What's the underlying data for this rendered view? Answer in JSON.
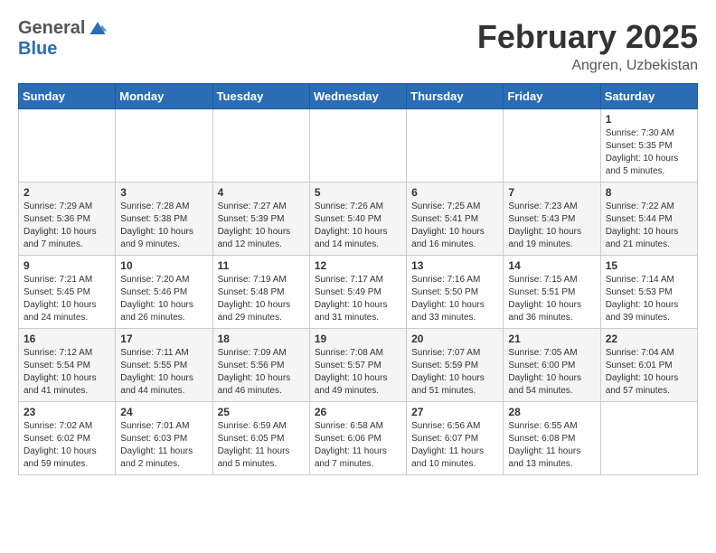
{
  "header": {
    "logo_general": "General",
    "logo_blue": "Blue",
    "month_title": "February 2025",
    "location": "Angren, Uzbekistan"
  },
  "days_of_week": [
    "Sunday",
    "Monday",
    "Tuesday",
    "Wednesday",
    "Thursday",
    "Friday",
    "Saturday"
  ],
  "weeks": [
    [
      {
        "day": "",
        "info": ""
      },
      {
        "day": "",
        "info": ""
      },
      {
        "day": "",
        "info": ""
      },
      {
        "day": "",
        "info": ""
      },
      {
        "day": "",
        "info": ""
      },
      {
        "day": "",
        "info": ""
      },
      {
        "day": "1",
        "info": "Sunrise: 7:30 AM\nSunset: 5:35 PM\nDaylight: 10 hours and 5 minutes."
      }
    ],
    [
      {
        "day": "2",
        "info": "Sunrise: 7:29 AM\nSunset: 5:36 PM\nDaylight: 10 hours and 7 minutes."
      },
      {
        "day": "3",
        "info": "Sunrise: 7:28 AM\nSunset: 5:38 PM\nDaylight: 10 hours and 9 minutes."
      },
      {
        "day": "4",
        "info": "Sunrise: 7:27 AM\nSunset: 5:39 PM\nDaylight: 10 hours and 12 minutes."
      },
      {
        "day": "5",
        "info": "Sunrise: 7:26 AM\nSunset: 5:40 PM\nDaylight: 10 hours and 14 minutes."
      },
      {
        "day": "6",
        "info": "Sunrise: 7:25 AM\nSunset: 5:41 PM\nDaylight: 10 hours and 16 minutes."
      },
      {
        "day": "7",
        "info": "Sunrise: 7:23 AM\nSunset: 5:43 PM\nDaylight: 10 hours and 19 minutes."
      },
      {
        "day": "8",
        "info": "Sunrise: 7:22 AM\nSunset: 5:44 PM\nDaylight: 10 hours and 21 minutes."
      }
    ],
    [
      {
        "day": "9",
        "info": "Sunrise: 7:21 AM\nSunset: 5:45 PM\nDaylight: 10 hours and 24 minutes."
      },
      {
        "day": "10",
        "info": "Sunrise: 7:20 AM\nSunset: 5:46 PM\nDaylight: 10 hours and 26 minutes."
      },
      {
        "day": "11",
        "info": "Sunrise: 7:19 AM\nSunset: 5:48 PM\nDaylight: 10 hours and 29 minutes."
      },
      {
        "day": "12",
        "info": "Sunrise: 7:17 AM\nSunset: 5:49 PM\nDaylight: 10 hours and 31 minutes."
      },
      {
        "day": "13",
        "info": "Sunrise: 7:16 AM\nSunset: 5:50 PM\nDaylight: 10 hours and 33 minutes."
      },
      {
        "day": "14",
        "info": "Sunrise: 7:15 AM\nSunset: 5:51 PM\nDaylight: 10 hours and 36 minutes."
      },
      {
        "day": "15",
        "info": "Sunrise: 7:14 AM\nSunset: 5:53 PM\nDaylight: 10 hours and 39 minutes."
      }
    ],
    [
      {
        "day": "16",
        "info": "Sunrise: 7:12 AM\nSunset: 5:54 PM\nDaylight: 10 hours and 41 minutes."
      },
      {
        "day": "17",
        "info": "Sunrise: 7:11 AM\nSunset: 5:55 PM\nDaylight: 10 hours and 44 minutes."
      },
      {
        "day": "18",
        "info": "Sunrise: 7:09 AM\nSunset: 5:56 PM\nDaylight: 10 hours and 46 minutes."
      },
      {
        "day": "19",
        "info": "Sunrise: 7:08 AM\nSunset: 5:57 PM\nDaylight: 10 hours and 49 minutes."
      },
      {
        "day": "20",
        "info": "Sunrise: 7:07 AM\nSunset: 5:59 PM\nDaylight: 10 hours and 51 minutes."
      },
      {
        "day": "21",
        "info": "Sunrise: 7:05 AM\nSunset: 6:00 PM\nDaylight: 10 hours and 54 minutes."
      },
      {
        "day": "22",
        "info": "Sunrise: 7:04 AM\nSunset: 6:01 PM\nDaylight: 10 hours and 57 minutes."
      }
    ],
    [
      {
        "day": "23",
        "info": "Sunrise: 7:02 AM\nSunset: 6:02 PM\nDaylight: 10 hours and 59 minutes."
      },
      {
        "day": "24",
        "info": "Sunrise: 7:01 AM\nSunset: 6:03 PM\nDaylight: 11 hours and 2 minutes."
      },
      {
        "day": "25",
        "info": "Sunrise: 6:59 AM\nSunset: 6:05 PM\nDaylight: 11 hours and 5 minutes."
      },
      {
        "day": "26",
        "info": "Sunrise: 6:58 AM\nSunset: 6:06 PM\nDaylight: 11 hours and 7 minutes."
      },
      {
        "day": "27",
        "info": "Sunrise: 6:56 AM\nSunset: 6:07 PM\nDaylight: 11 hours and 10 minutes."
      },
      {
        "day": "28",
        "info": "Sunrise: 6:55 AM\nSunset: 6:08 PM\nDaylight: 11 hours and 13 minutes."
      },
      {
        "day": "",
        "info": ""
      }
    ]
  ]
}
